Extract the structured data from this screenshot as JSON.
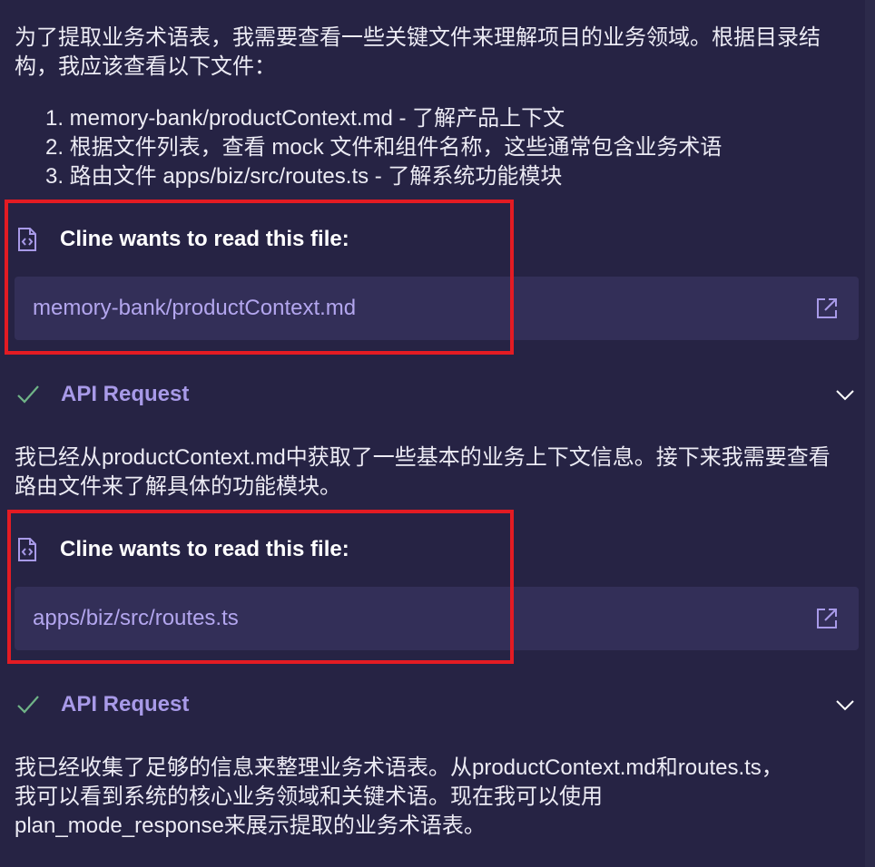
{
  "messages": {
    "intro": "为了提取业务术语表，我需要查看一些关键文件来理解项目的业务领域。根据目录结构，我应该查看以下文件：",
    "list": [
      "1. memory-bank/productContext.md - 了解产品上下文",
      "2. 根据文件列表，查看 mock 文件和组件名称，这些通常包含业务术语",
      "3. 路由文件 apps/biz/src/routes.ts - 了解系统功能模块"
    ],
    "after_first_request": "我已经从productContext.md中获取了一些基本的业务上下文信息。接下来我需要查看路由文件来了解具体的功能模块。",
    "after_second_request": "我已经收集了足够的信息来整理业务术语表。从productContext.md和routes.ts，我可以看到系统的核心业务领域和关键术语。现在我可以使用plan_mode_response来展示提取的业务术语表。"
  },
  "read_file_1": {
    "title": "Cline wants to read this file:",
    "path": "memory-bank/productContext.md"
  },
  "read_file_2": {
    "title": "Cline wants to read this file:",
    "path": "apps/biz/src/routes.ts"
  },
  "api_request_1": {
    "label": "API Request"
  },
  "api_request_2": {
    "label": "API Request"
  },
  "icons": {
    "file_code": "file-code-icon",
    "open_external": "open-external-icon",
    "check": "check-icon",
    "chevron": "chevron-down-icon"
  },
  "colors": {
    "background": "#262344",
    "path_box": "#332f58",
    "path_text": "#b3a6ee",
    "api_label": "#a89ae8",
    "check": "#6fb387",
    "highlight": "#e31b23"
  }
}
